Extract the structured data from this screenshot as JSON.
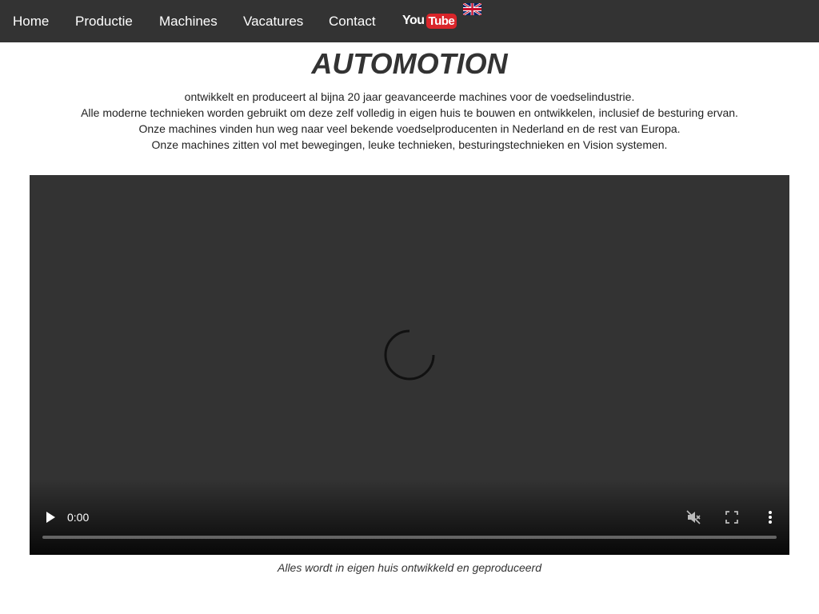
{
  "nav": {
    "items": [
      {
        "label": "Home"
      },
      {
        "label": "Productie"
      },
      {
        "label": "Machines"
      },
      {
        "label": "Vacatures"
      },
      {
        "label": "Contact"
      }
    ],
    "youtube_logo": {
      "you": "You",
      "tube": "Tube",
      "icon": "youtube-logo"
    },
    "language_flag": {
      "icon": "uk-flag-icon"
    }
  },
  "header": {
    "title": "AUTOMOTION"
  },
  "intro": {
    "lines": [
      "ontwikkelt en produceert al bijna 20 jaar geavanceerde machines voor de voedselindustrie.",
      "Alle moderne technieken worden gebruikt om deze zelf volledig in eigen huis te bouwen en ontwikkelen, inclusief de besturing ervan.",
      "Onze machines vinden hun weg naar veel bekende voedselproducenten in Nederland en de rest van Europa.",
      "Onze machines zitten vol met bewegingen, leuke technieken, besturingstechnieken en Vision systemen."
    ]
  },
  "video": {
    "current_time": "0:00",
    "progress": 0,
    "muted": true,
    "controls": [
      "play-icon",
      "muted-speaker-icon",
      "fullscreen-icon",
      "more-options-icon"
    ],
    "caption": "Alles wordt in eigen huis ontwikkeld en geproduceerd"
  },
  "colors": {
    "navbar_bg": "#333333",
    "video_bg": "#333333",
    "youtube_red": "#d9252a"
  }
}
